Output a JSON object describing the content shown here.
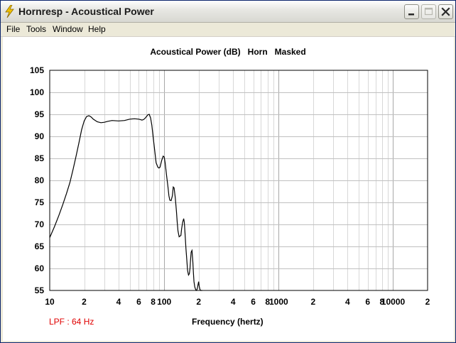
{
  "window": {
    "title": "Hornresp - Acoustical Power"
  },
  "menu": {
    "items": [
      "File",
      "Tools",
      "Window",
      "Help"
    ]
  },
  "chart_data": {
    "type": "line",
    "title": "Acoustical Power (dB)   Horn   Masked",
    "xlabel": "Frequency (hertz)",
    "ylabel": "",
    "x_scale": "log",
    "xlim": [
      10,
      20000
    ],
    "ylim": [
      55,
      105
    ],
    "y_ticks": [
      105,
      100,
      95,
      90,
      85,
      80,
      75,
      70,
      65,
      60,
      55
    ],
    "x_tick_labels": [
      "10",
      "2",
      "4",
      "6",
      "8",
      "100",
      "2",
      "4",
      "6",
      "8",
      "1000",
      "2",
      "4",
      "6",
      "8",
      "10000",
      "2"
    ],
    "x_tick_values": [
      10,
      20,
      40,
      60,
      80,
      100,
      200,
      400,
      600,
      800,
      1000,
      2000,
      4000,
      6000,
      8000,
      10000,
      20000
    ],
    "grid": true,
    "line_color": "#000000",
    "series": [
      {
        "x": [
          10,
          11,
          12,
          13,
          14,
          15,
          16,
          17,
          18,
          19,
          20,
          21,
          22,
          23,
          24,
          26,
          28,
          30,
          32,
          35,
          40,
          45,
          50,
          55,
          60,
          62,
          64,
          66,
          68,
          70,
          72,
          74,
          76,
          78,
          80,
          82,
          85,
          88,
          90,
          92,
          95,
          98,
          100,
          102,
          105,
          108,
          110,
          112,
          115,
          118,
          120,
          122,
          125,
          128,
          130,
          132,
          135,
          140,
          142,
          145,
          148,
          150,
          152,
          155,
          158,
          160,
          163,
          166,
          168,
          170,
          172,
          175,
          178,
          180,
          182,
          185,
          188,
          190,
          192,
          195,
          198,
          200,
          202,
          205,
          208,
          210,
          212,
          215
        ],
        "y": [
          67,
          69.5,
          72,
          74.5,
          77,
          79.5,
          82.5,
          85.5,
          88.5,
          91.5,
          93.5,
          94.5,
          94.7,
          94.4,
          93.9,
          93.3,
          93.1,
          93.2,
          93.4,
          93.6,
          93.5,
          93.6,
          93.9,
          94,
          93.9,
          93.8,
          93.7,
          93.8,
          94.1,
          94.5,
          94.9,
          95,
          94.2,
          92.5,
          90,
          87.5,
          84,
          83,
          82.8,
          83,
          84.5,
          85.5,
          85.3,
          84,
          81,
          78.5,
          76.5,
          75.5,
          75.4,
          76.5,
          78.5,
          78.3,
          76,
          73,
          70.5,
          68.5,
          67.2,
          67.5,
          69,
          70.5,
          71.3,
          70.5,
          68,
          64.5,
          61.5,
          59.5,
          58.5,
          58.8,
          60,
          62,
          63.7,
          64.1,
          61.5,
          59,
          57,
          55.8,
          55.3,
          55,
          55,
          55.5,
          56.5,
          57,
          56,
          55.3,
          55,
          55,
          55,
          55
        ]
      }
    ]
  },
  "annotations": {
    "lpf_text": "LPF : 64 Hz",
    "lpf_color": "#e00000"
  }
}
